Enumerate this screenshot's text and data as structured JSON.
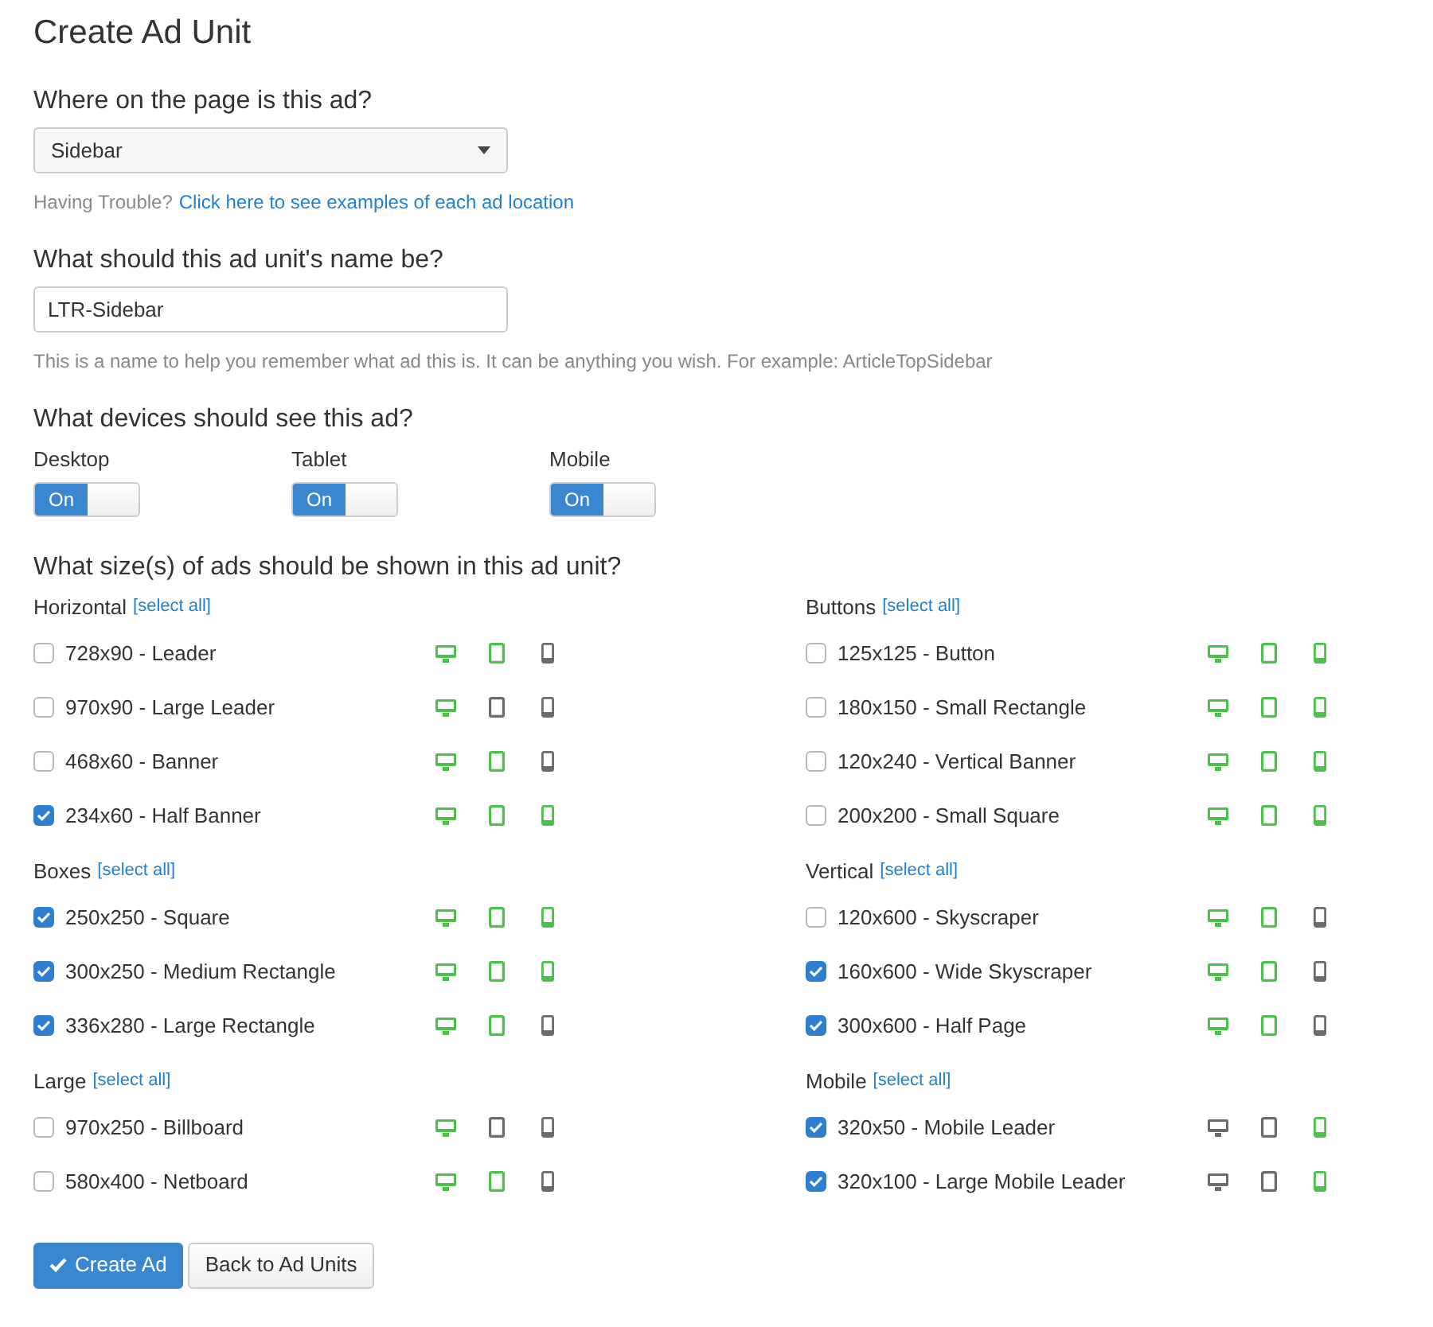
{
  "title": "Create Ad Unit",
  "location": {
    "question": "Where on the page is this ad?",
    "value": "Sidebar",
    "help_prefix": "Having Trouble?",
    "help_link": "Click here to see examples of each ad location"
  },
  "name": {
    "question": "What should this ad unit's name be?",
    "value": "LTR-Sidebar",
    "help": "This is a name to help you remember what ad this is. It can be anything you wish. For example: ArticleTopSidebar"
  },
  "devices": {
    "question": "What devices should see this ad?",
    "items": [
      {
        "label": "Desktop",
        "on": true,
        "toggle_text": "On"
      },
      {
        "label": "Tablet",
        "on": true,
        "toggle_text": "On"
      },
      {
        "label": "Mobile",
        "on": true,
        "toggle_text": "On"
      }
    ]
  },
  "sizes": {
    "question": "What size(s) of ads should be shown in this ad unit?",
    "columns": [
      {
        "groups": [
          {
            "title": "Horizontal",
            "select_all": "[select all]",
            "items": [
              {
                "label": "728x90 - Leader",
                "checked": false,
                "desktop": true,
                "tablet": true,
                "mobile": false
              },
              {
                "label": "970x90 - Large Leader",
                "checked": false,
                "desktop": true,
                "tablet": false,
                "mobile": false
              },
              {
                "label": "468x60 - Banner",
                "checked": false,
                "desktop": true,
                "tablet": true,
                "mobile": false
              },
              {
                "label": "234x60 - Half Banner",
                "checked": true,
                "desktop": true,
                "tablet": true,
                "mobile": true
              }
            ]
          },
          {
            "title": "Boxes",
            "select_all": "[select all]",
            "items": [
              {
                "label": "250x250 - Square",
                "checked": true,
                "desktop": true,
                "tablet": true,
                "mobile": true
              },
              {
                "label": "300x250 - Medium Rectangle",
                "checked": true,
                "desktop": true,
                "tablet": true,
                "mobile": true
              },
              {
                "label": "336x280 - Large Rectangle",
                "checked": true,
                "desktop": true,
                "tablet": true,
                "mobile": false
              }
            ]
          },
          {
            "title": "Large",
            "select_all": "[select all]",
            "items": [
              {
                "label": "970x250 - Billboard",
                "checked": false,
                "desktop": true,
                "tablet": false,
                "mobile": false
              },
              {
                "label": "580x400 - Netboard",
                "checked": false,
                "desktop": true,
                "tablet": true,
                "mobile": false
              }
            ]
          }
        ]
      },
      {
        "groups": [
          {
            "title": "Buttons",
            "select_all": "[select all]",
            "items": [
              {
                "label": "125x125 - Button",
                "checked": false,
                "desktop": true,
                "tablet": true,
                "mobile": true
              },
              {
                "label": "180x150 - Small Rectangle",
                "checked": false,
                "desktop": true,
                "tablet": true,
                "mobile": true
              },
              {
                "label": "120x240 - Vertical Banner",
                "checked": false,
                "desktop": true,
                "tablet": true,
                "mobile": true
              },
              {
                "label": "200x200 - Small Square",
                "checked": false,
                "desktop": true,
                "tablet": true,
                "mobile": true
              }
            ]
          },
          {
            "title": "Vertical",
            "select_all": "[select all]",
            "items": [
              {
                "label": "120x600 - Skyscraper",
                "checked": false,
                "desktop": true,
                "tablet": true,
                "mobile": false
              },
              {
                "label": "160x600 - Wide Skyscraper",
                "checked": true,
                "desktop": true,
                "tablet": true,
                "mobile": false
              },
              {
                "label": "300x600 - Half Page",
                "checked": true,
                "desktop": true,
                "tablet": true,
                "mobile": false
              }
            ]
          },
          {
            "title": "Mobile",
            "select_all": "[select all]",
            "items": [
              {
                "label": "320x50 - Mobile Leader",
                "checked": true,
                "desktop": false,
                "tablet": false,
                "mobile": true
              },
              {
                "label": "320x100 - Large Mobile Leader",
                "checked": true,
                "desktop": false,
                "tablet": false,
                "mobile": true
              }
            ]
          }
        ]
      }
    ]
  },
  "buttons": {
    "create": "Create Ad",
    "back": "Back to Ad Units"
  }
}
